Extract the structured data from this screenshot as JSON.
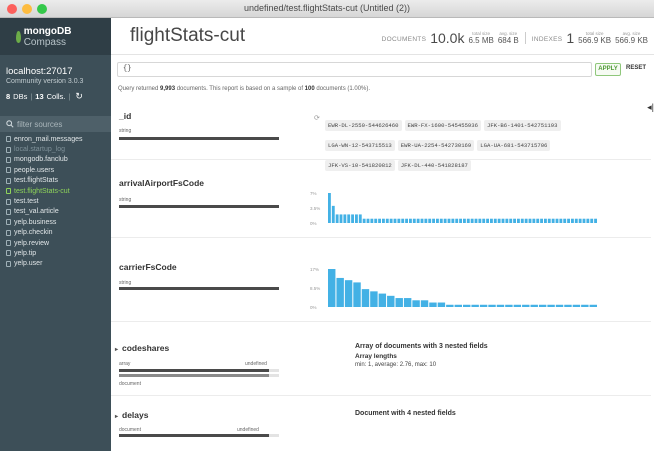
{
  "window": {
    "title": "undefined/test.flightStats-cut (Untitled (2))",
    "lights": [
      "#fc605c",
      "#fdbc40",
      "#34c84a"
    ]
  },
  "sidebar": {
    "logo_bold": "mongoDB",
    "logo_rest": " Compass",
    "host": "localhost:27017",
    "version": "Community version 3.0.3",
    "dbs_count": "8",
    "dbs_label": "DBs",
    "colls_count": "13",
    "colls_label": "Colls.",
    "refresh_icon": "↻",
    "filter_placeholder": "filter sources",
    "collections": [
      {
        "name": "enron_mail.messages",
        "state": "normal"
      },
      {
        "name": "local.startup_log",
        "state": "dim"
      },
      {
        "name": "mongodb.fanclub",
        "state": "normal"
      },
      {
        "name": "people.users",
        "state": "normal"
      },
      {
        "name": "test.flightStats",
        "state": "normal"
      },
      {
        "name": "test.flightStats-cut",
        "state": "active"
      },
      {
        "name": "test.test",
        "state": "normal"
      },
      {
        "name": "test_val.article",
        "state": "normal"
      },
      {
        "name": "yelp.business",
        "state": "normal"
      },
      {
        "name": "yelp.checkin",
        "state": "normal"
      },
      {
        "name": "yelp.review",
        "state": "normal"
      },
      {
        "name": "yelp.tip",
        "state": "normal"
      },
      {
        "name": "yelp.user",
        "state": "normal"
      }
    ],
    "accent": "#8fd45a"
  },
  "header": {
    "collection_name": "flightStats-cut",
    "documents_label": "DOCUMENTS",
    "documents_value": "10.0k",
    "total_size_cap": "total size",
    "total_size_value": "6.5 MB",
    "avg_size_cap": "avg. size",
    "avg_size_value": "684 B",
    "indexes_label": "INDEXES",
    "indexes_value": "1",
    "idx_total_cap": "total size",
    "idx_total_value": "566.9 KB",
    "idx_avg_cap": "avg. size",
    "idx_avg_value": "566.9 KB"
  },
  "query": {
    "value": "{}",
    "apply_label": "APPLY",
    "reset_label": "RESET"
  },
  "summary": {
    "prefix": "Query returned ",
    "count": "9,993",
    "middle": " documents. This report is based on a sample of ",
    "sample": "100",
    "suffix": " documents (1.00%)."
  },
  "expand_icon": "◂|",
  "fields": {
    "id": {
      "name": "_id",
      "type": "string",
      "shuffle_icon": "⟳",
      "values": [
        "EWR-DL-2550-544626460",
        "EWR-FX-1600-545455936",
        "JFK-B6-1401-542751193",
        "LGA-WN-12-543715513",
        "EWR-UA-2254-542730169",
        "LGA-UA-681-543715706",
        "JFK-VS-10-541820812",
        "JFK-DL-440-541828187"
      ]
    },
    "arrival": {
      "name": "arrivalAirportFsCode",
      "type": "string"
    },
    "carrier": {
      "name": "carrierFsCode",
      "type": "string"
    },
    "codeshares": {
      "caret": "▸",
      "name": "codeshares",
      "type_left": "array",
      "type_right": "undefined",
      "type_sub": "document",
      "desc": "Array of documents with 3 nested fields",
      "lengths_label": "Array lengths",
      "minmax": "min: 1,   average: 2.76,   max: 10"
    },
    "delays": {
      "caret": "▸",
      "name": "delays",
      "type_left": "document",
      "type_right": "undefined",
      "desc": "Document with 4 nested fields"
    }
  },
  "chart_data": [
    {
      "type": "bar",
      "title": "",
      "ylabel": "",
      "yticks": [
        "7%",
        "3.5%",
        "0%"
      ],
      "ylim": [
        0,
        7
      ],
      "values": [
        7,
        4,
        2,
        2,
        2,
        2,
        2,
        2,
        2,
        1,
        1,
        1,
        1,
        1,
        1,
        1,
        1,
        1,
        1,
        1,
        1,
        1,
        1,
        1,
        1,
        1,
        1,
        1,
        1,
        1,
        1,
        1,
        1,
        1,
        1,
        1,
        1,
        1,
        1,
        1,
        1,
        1,
        1,
        1,
        1,
        1,
        1,
        1,
        1,
        1,
        1,
        1,
        1,
        1,
        1,
        1,
        1,
        1,
        1,
        1,
        1,
        1,
        1,
        1,
        1,
        1,
        1,
        1,
        1,
        1
      ],
      "color": "#43b1e5"
    },
    {
      "type": "bar",
      "title": "",
      "ylabel": "",
      "yticks": [
        "17%",
        "8.5%",
        "0%"
      ],
      "ylim": [
        0,
        17
      ],
      "values": [
        17,
        13,
        12,
        11,
        8,
        7,
        6,
        5,
        4,
        4,
        3,
        3,
        2,
        2,
        1,
        1,
        1,
        1,
        1,
        1,
        1,
        1,
        1,
        1,
        1,
        1,
        1,
        1,
        1,
        1,
        1,
        1
      ],
      "color": "#43b1e5"
    }
  ]
}
